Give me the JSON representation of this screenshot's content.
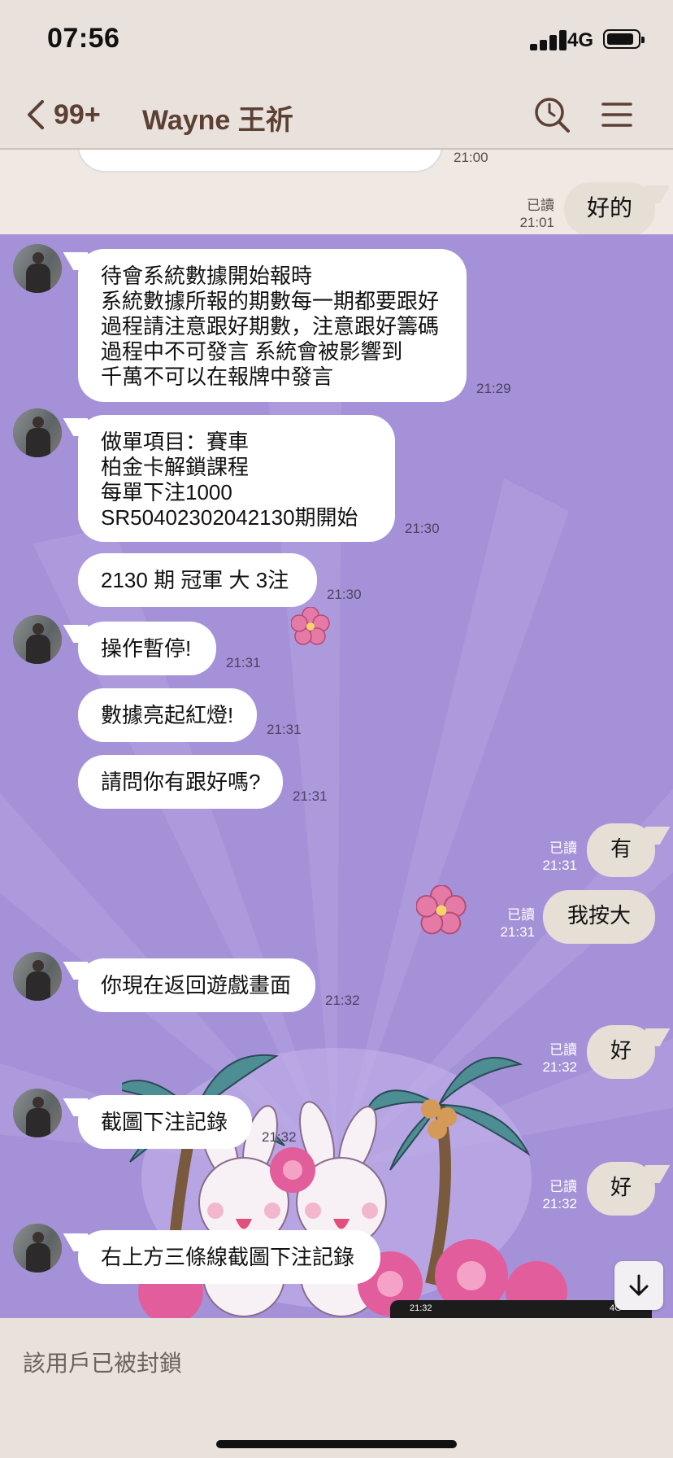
{
  "status_bar": {
    "time": "07:56",
    "network": "4G"
  },
  "nav": {
    "back_count": "99+",
    "title": "Wayne 王祈"
  },
  "top_strip": {
    "partial_time": "21:00",
    "reply_read": "已讀",
    "reply_time": "21:01",
    "reply_text": "好的"
  },
  "messages": [
    {
      "text": "待會系統數據開始報時\n系統數據所報的期數每一期都要跟好\n過程請注意跟好期數，注意跟好籌碼\n過程中不可發言 系統會被影響到\n千萬不可以在報牌中發言",
      "time": "21:29"
    },
    {
      "text": "做單項目：賽車\n柏金卡解鎖課程\n每單下注1000\nSR50402302042130期開始",
      "time": "21:30"
    },
    {
      "text": "2130 期 冠軍 大 3注",
      "time": "21:30"
    },
    {
      "text": "操作暫停!",
      "time": "21:31"
    },
    {
      "text": "數據亮起紅燈!",
      "time": "21:31"
    },
    {
      "text": "請問你有跟好嗎?",
      "time": "21:31"
    },
    {
      "text": "你現在返回遊戲畫面",
      "time": "21:32"
    },
    {
      "text": "截圖下注記錄",
      "time": "21:32"
    },
    {
      "text": "右上方三條線截圖下注記錄",
      "time": ""
    }
  ],
  "my_messages": [
    {
      "text": "有",
      "read": "已讀",
      "time": "21:31"
    },
    {
      "text": "我按大",
      "read": "已讀",
      "time": "21:31"
    },
    {
      "text": "好",
      "read": "已讀",
      "time": "21:32"
    },
    {
      "text": "好",
      "read": "已讀",
      "time": "21:32"
    }
  ],
  "mini_preview": {
    "time": "21:32",
    "network": "4G"
  },
  "footer": {
    "blocked_text": "該用戶已被封鎖"
  },
  "colors": {
    "chat_bg": "#a591d8",
    "brown": "#5c4033",
    "my_bubble": "#e6dfd6"
  }
}
